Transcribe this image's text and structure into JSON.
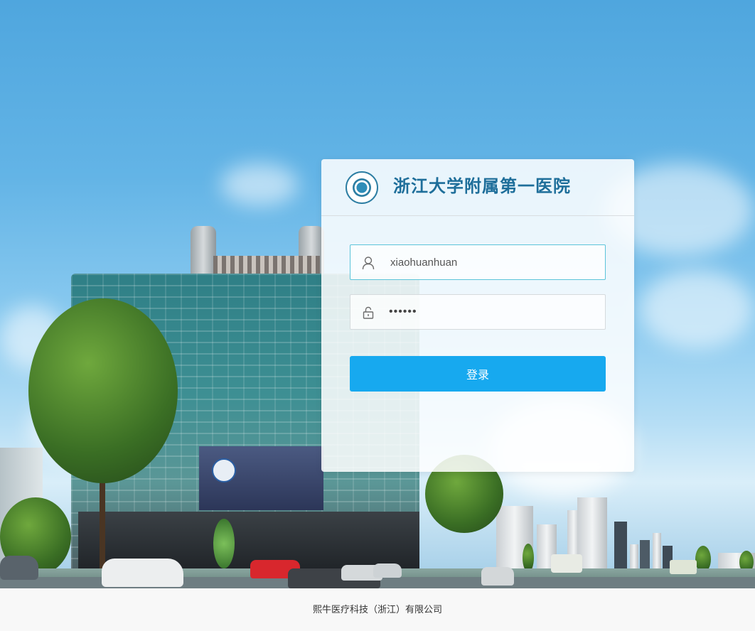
{
  "header": {
    "hospital_name": "浙江大学附属第一医院"
  },
  "form": {
    "username": {
      "value": "xiaohuanhuan",
      "icon": "user-icon"
    },
    "password": {
      "value": "••••••",
      "icon": "lock-icon"
    },
    "login_label": "登录"
  },
  "footer": {
    "company": "熙牛医疗科技（浙江）有限公司"
  },
  "colors": {
    "accent": "#17a9ef",
    "title": "#1e6e9a",
    "focus_border": "#5cc4da"
  }
}
